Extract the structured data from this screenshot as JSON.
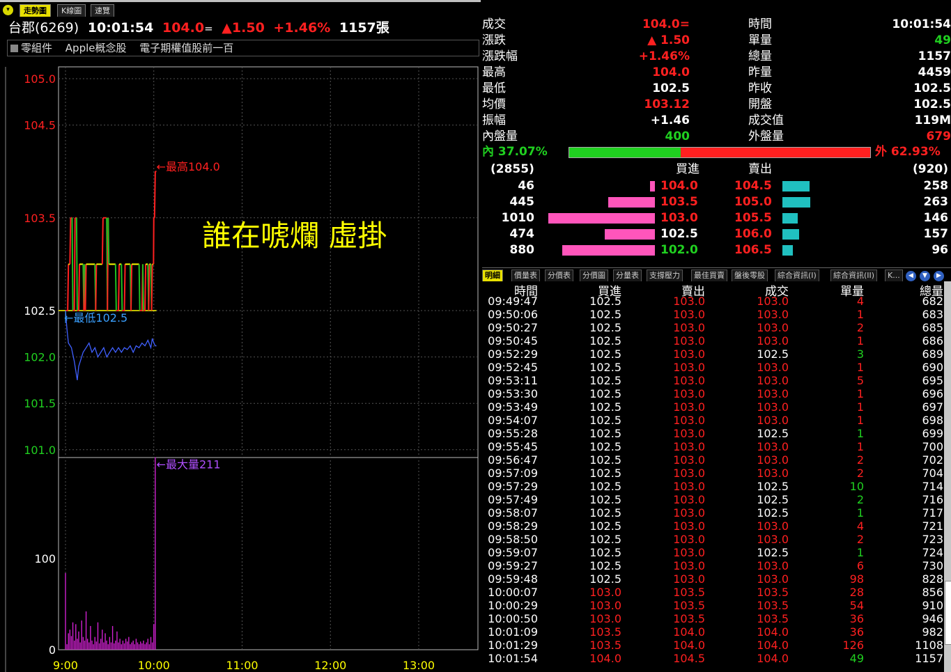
{
  "tabs": [
    {
      "label": "走勢圖",
      "active": true
    },
    {
      "label": "K線圖",
      "active": false
    },
    {
      "label": "速覽",
      "active": false
    }
  ],
  "header": {
    "name": "台郡(6269)",
    "time": "10:01:54",
    "price": "104.0",
    "price_mark": "=",
    "change": "1.50",
    "change_pct": "+1.46%",
    "volume": "1157張"
  },
  "categories": [
    "零組件",
    "Apple概念股",
    "電子期權值股前一百"
  ],
  "chart_data": {
    "type": "line",
    "price_axis": {
      "ticks": [
        "105.0",
        "104.5",
        "103.5",
        "102.5",
        "102.0",
        "101.5",
        "101.0"
      ],
      "ylim": [
        101.0,
        105.25
      ]
    },
    "volume_axis": {
      "ticks": [
        "100",
        "0"
      ],
      "ylim": [
        0,
        211
      ]
    },
    "time_ticks": [
      "9:00",
      "10:00",
      "11:00",
      "12:00",
      "13:00"
    ],
    "xlim_minutes": [
      0,
      270
    ],
    "reference_price": 102.5,
    "price_series": [
      [
        0,
        102.5
      ],
      [
        1.5,
        102.5
      ],
      [
        2,
        103.0
      ],
      [
        3,
        103.0
      ],
      [
        3.5,
        103.5
      ],
      [
        4.5,
        103.5
      ],
      [
        5,
        102.5
      ],
      [
        6,
        102.5
      ],
      [
        6.5,
        103.5
      ],
      [
        7.5,
        103.5
      ],
      [
        8,
        102.5
      ],
      [
        9,
        102.5
      ],
      [
        9.5,
        103.0
      ],
      [
        12,
        103.0
      ],
      [
        12.5,
        102.5
      ],
      [
        13,
        103.0
      ],
      [
        13.5,
        102.5
      ],
      [
        14,
        103.0
      ],
      [
        20,
        103.0
      ],
      [
        20.5,
        102.5
      ],
      [
        21,
        103.0
      ],
      [
        25,
        103.0
      ],
      [
        25.5,
        103.5
      ],
      [
        28,
        103.5
      ],
      [
        28.5,
        102.5
      ],
      [
        29,
        103.5
      ],
      [
        29.5,
        103.0
      ],
      [
        34,
        103.0
      ],
      [
        34.5,
        102.5
      ],
      [
        36,
        102.5
      ],
      [
        36.5,
        103.0
      ],
      [
        38,
        103.0
      ],
      [
        38.5,
        102.5
      ],
      [
        40,
        102.5
      ],
      [
        40.5,
        103.0
      ],
      [
        44,
        103.0
      ],
      [
        44.5,
        102.5
      ],
      [
        45,
        103.0
      ],
      [
        50,
        103.0
      ],
      [
        50.5,
        102.5
      ],
      [
        52,
        102.5
      ],
      [
        52.5,
        103.0
      ],
      [
        53,
        102.5
      ],
      [
        54,
        102.5
      ],
      [
        54.5,
        103.0
      ],
      [
        56,
        103.0
      ],
      [
        56.5,
        102.5
      ],
      [
        57,
        103.0
      ],
      [
        58,
        103.0
      ],
      [
        58.5,
        102.5
      ],
      [
        59,
        103.0
      ],
      [
        59.8,
        103.0
      ],
      [
        60,
        103.5
      ],
      [
        60.5,
        103.5
      ],
      [
        61,
        104.0
      ],
      [
        61.8,
        104.0
      ]
    ],
    "avg_series": [
      [
        0,
        102.5
      ],
      [
        1,
        102.3
      ],
      [
        2,
        102.15
      ],
      [
        4,
        102.1
      ],
      [
        6,
        101.95
      ],
      [
        7,
        101.85
      ],
      [
        8,
        101.75
      ],
      [
        9,
        101.9
      ],
      [
        10,
        101.95
      ],
      [
        12,
        102.05
      ],
      [
        14,
        102.1
      ],
      [
        16,
        102.15
      ],
      [
        18,
        102.05
      ],
      [
        20,
        102.1
      ],
      [
        22,
        102.0
      ],
      [
        24,
        102.05
      ],
      [
        26,
        102.1
      ],
      [
        28,
        102.0
      ],
      [
        30,
        102.05
      ],
      [
        32,
        102.1
      ],
      [
        34,
        102.05
      ],
      [
        36,
        102.1
      ],
      [
        38,
        102.05
      ],
      [
        40,
        102.1
      ],
      [
        42,
        102.08
      ],
      [
        44,
        102.12
      ],
      [
        46,
        102.05
      ],
      [
        48,
        102.12
      ],
      [
        50,
        102.1
      ],
      [
        52,
        102.15
      ],
      [
        54,
        102.12
      ],
      [
        56,
        102.18
      ],
      [
        58,
        102.1
      ],
      [
        59,
        102.2
      ],
      [
        60,
        102.15
      ],
      [
        61,
        102.12
      ],
      [
        61.8,
        102.12
      ]
    ],
    "volume_series": [
      [
        0,
        84
      ],
      [
        1,
        6
      ],
      [
        2,
        18
      ],
      [
        3,
        22
      ],
      [
        4,
        15
      ],
      [
        5,
        30
      ],
      [
        6,
        10
      ],
      [
        7,
        28
      ],
      [
        8,
        12
      ],
      [
        9,
        20
      ],
      [
        10,
        8
      ],
      [
        11,
        32
      ],
      [
        12,
        14
      ],
      [
        13,
        10
      ],
      [
        14,
        42
      ],
      [
        15,
        12
      ],
      [
        16,
        8
      ],
      [
        17,
        26
      ],
      [
        18,
        10
      ],
      [
        19,
        6
      ],
      [
        20,
        14
      ],
      [
        21,
        9
      ],
      [
        22,
        30
      ],
      [
        23,
        7
      ],
      [
        24,
        12
      ],
      [
        25,
        22
      ],
      [
        26,
        8
      ],
      [
        27,
        18
      ],
      [
        28,
        10
      ],
      [
        29,
        6
      ],
      [
        30,
        14
      ],
      [
        31,
        8
      ],
      [
        32,
        26
      ],
      [
        33,
        7
      ],
      [
        34,
        10
      ],
      [
        35,
        20
      ],
      [
        36,
        8
      ],
      [
        37,
        12
      ],
      [
        38,
        6
      ],
      [
        39,
        10
      ],
      [
        40,
        7
      ],
      [
        41,
        12
      ],
      [
        42,
        9
      ],
      [
        43,
        14
      ],
      [
        44,
        6
      ],
      [
        45,
        8
      ],
      [
        46,
        10
      ],
      [
        47,
        6
      ],
      [
        48,
        12
      ],
      [
        49,
        8
      ],
      [
        50,
        6
      ],
      [
        51,
        9
      ],
      [
        52,
        7
      ],
      [
        53,
        10
      ],
      [
        54,
        6
      ],
      [
        55,
        8
      ],
      [
        56,
        12
      ],
      [
        57,
        6
      ],
      [
        58,
        14
      ],
      [
        59,
        8
      ],
      [
        60,
        28
      ],
      [
        61,
        211
      ]
    ],
    "annotations": {
      "high": "←最高104.0",
      "low": "←最低102.5",
      "max_volume": "←最大量211"
    },
    "overlay_text": "誰在唬爛 虛掛"
  },
  "quote": {
    "left": [
      {
        "label": "成交",
        "value": "104.0=",
        "color": "red"
      },
      {
        "label": "漲跌",
        "value": "▲ 1.50",
        "color": "red"
      },
      {
        "label": "漲跌幅",
        "value": "+1.46%",
        "color": "red"
      },
      {
        "label": "最高",
        "value": "104.0",
        "color": "red"
      },
      {
        "label": "最低",
        "value": "102.5",
        "color": "white"
      },
      {
        "label": "均價",
        "value": "103.12",
        "color": "red"
      },
      {
        "label": "振幅",
        "value": "+1.46",
        "color": "white"
      },
      {
        "label": "內盤量",
        "value": "400",
        "color": "green"
      }
    ],
    "right": [
      {
        "label": "時間",
        "value": "10:01:54",
        "color": "white"
      },
      {
        "label": "單量",
        "value": "49",
        "color": "green"
      },
      {
        "label": "總量",
        "value": "1157",
        "color": "white"
      },
      {
        "label": "昨量",
        "value": "4459",
        "color": "white"
      },
      {
        "label": "昨收",
        "value": "102.5",
        "color": "white"
      },
      {
        "label": "開盤",
        "value": "102.5",
        "color": "white"
      },
      {
        "label": "成交值",
        "value": "119M",
        "color": "white"
      },
      {
        "label": "外盤量",
        "value": "679",
        "color": "red"
      }
    ]
  },
  "ratio": {
    "in_label": "內",
    "in_pct": "37.07%",
    "out_label": "外",
    "out_pct": "62.93%",
    "in_value": 0.3707
  },
  "orderbook": {
    "bid_total": "(2855)",
    "ask_total": "(920)",
    "bid_header": "買進",
    "ask_header": "賣出",
    "rows": [
      {
        "bid_vol": "46",
        "bid": "104.0",
        "ask": "104.5",
        "ask_vol": "258",
        "bid_n": 46,
        "ask_n": 258
      },
      {
        "bid_vol": "445",
        "bid": "103.5",
        "ask": "105.0",
        "ask_vol": "263",
        "bid_n": 445,
        "ask_n": 263
      },
      {
        "bid_vol": "1010",
        "bid": "103.0",
        "ask": "105.5",
        "ask_vol": "146",
        "bid_n": 1010,
        "ask_n": 146
      },
      {
        "bid_vol": "474",
        "bid": "102.5",
        "ask": "106.0",
        "ask_vol": "157",
        "bid_n": 474,
        "ask_n": 157
      },
      {
        "bid_vol": "880",
        "bid": "102.0",
        "ask": "106.5",
        "ask_vol": "96",
        "bid_n": 880,
        "ask_n": 96
      }
    ]
  },
  "detail_tabs": [
    "明細",
    "價量表",
    "分價表",
    "分價圖",
    "分量表",
    "支撐壓力",
    "最佳買賣",
    "盤後零股",
    "綜合資訊(I)",
    "綜合資訊(II)",
    "K..."
  ],
  "ticks": {
    "headers": [
      "時間",
      "買進",
      "賣出",
      "成交",
      "單量",
      "總量"
    ],
    "rows": [
      [
        "09:49:47",
        "102.5",
        "103.0",
        "103.0",
        "4",
        "682"
      ],
      [
        "09:50:06",
        "102.5",
        "103.0",
        "103.0",
        "1",
        "683"
      ],
      [
        "09:50:27",
        "102.5",
        "103.0",
        "103.0",
        "2",
        "685"
      ],
      [
        "09:50:45",
        "102.5",
        "103.0",
        "103.0",
        "1",
        "686"
      ],
      [
        "09:52:29",
        "102.5",
        "103.0",
        "102.5",
        "3",
        "689"
      ],
      [
        "09:52:45",
        "102.5",
        "103.0",
        "103.0",
        "1",
        "690"
      ],
      [
        "09:53:11",
        "102.5",
        "103.0",
        "103.0",
        "5",
        "695"
      ],
      [
        "09:53:30",
        "102.5",
        "103.0",
        "103.0",
        "1",
        "696"
      ],
      [
        "09:53:49",
        "102.5",
        "103.0",
        "103.0",
        "1",
        "697"
      ],
      [
        "09:54:07",
        "102.5",
        "103.0",
        "103.0",
        "1",
        "698"
      ],
      [
        "09:55:28",
        "102.5",
        "103.0",
        "102.5",
        "1",
        "699"
      ],
      [
        "09:55:45",
        "102.5",
        "103.0",
        "103.0",
        "1",
        "700"
      ],
      [
        "09:56:47",
        "102.5",
        "103.0",
        "103.0",
        "2",
        "702"
      ],
      [
        "09:57:09",
        "102.5",
        "103.0",
        "103.0",
        "2",
        "704"
      ],
      [
        "09:57:29",
        "102.5",
        "103.0",
        "102.5",
        "10",
        "714"
      ],
      [
        "09:57:49",
        "102.5",
        "103.0",
        "102.5",
        "2",
        "716"
      ],
      [
        "09:58:07",
        "102.5",
        "103.0",
        "102.5",
        "1",
        "717"
      ],
      [
        "09:58:29",
        "102.5",
        "103.0",
        "103.0",
        "4",
        "721"
      ],
      [
        "09:58:50",
        "102.5",
        "103.0",
        "103.0",
        "2",
        "723"
      ],
      [
        "09:59:07",
        "102.5",
        "103.0",
        "102.5",
        "1",
        "724"
      ],
      [
        "09:59:27",
        "102.5",
        "103.0",
        "103.0",
        "6",
        "730"
      ],
      [
        "09:59:48",
        "102.5",
        "103.0",
        "103.0",
        "98",
        "828"
      ],
      [
        "10:00:07",
        "103.0",
        "103.5",
        "103.5",
        "28",
        "856"
      ],
      [
        "10:00:29",
        "103.0",
        "103.5",
        "103.5",
        "54",
        "910"
      ],
      [
        "10:00:50",
        "103.0",
        "103.5",
        "103.5",
        "36",
        "946"
      ],
      [
        "10:01:09",
        "103.5",
        "104.0",
        "104.0",
        "36",
        "982"
      ],
      [
        "10:01:29",
        "103.5",
        "104.0",
        "104.0",
        "126",
        "1108"
      ],
      [
        "10:01:54",
        "104.0",
        "104.5",
        "104.0",
        "49",
        "1157"
      ]
    ]
  },
  "colors": {
    "up": "#ff2020",
    "down": "#20d020",
    "flat": "#ffffff",
    "bid_bar": "#ff55bb",
    "ask_bar": "#20c0c0",
    "avg": "#4060ff",
    "volume": "#d020d0"
  }
}
